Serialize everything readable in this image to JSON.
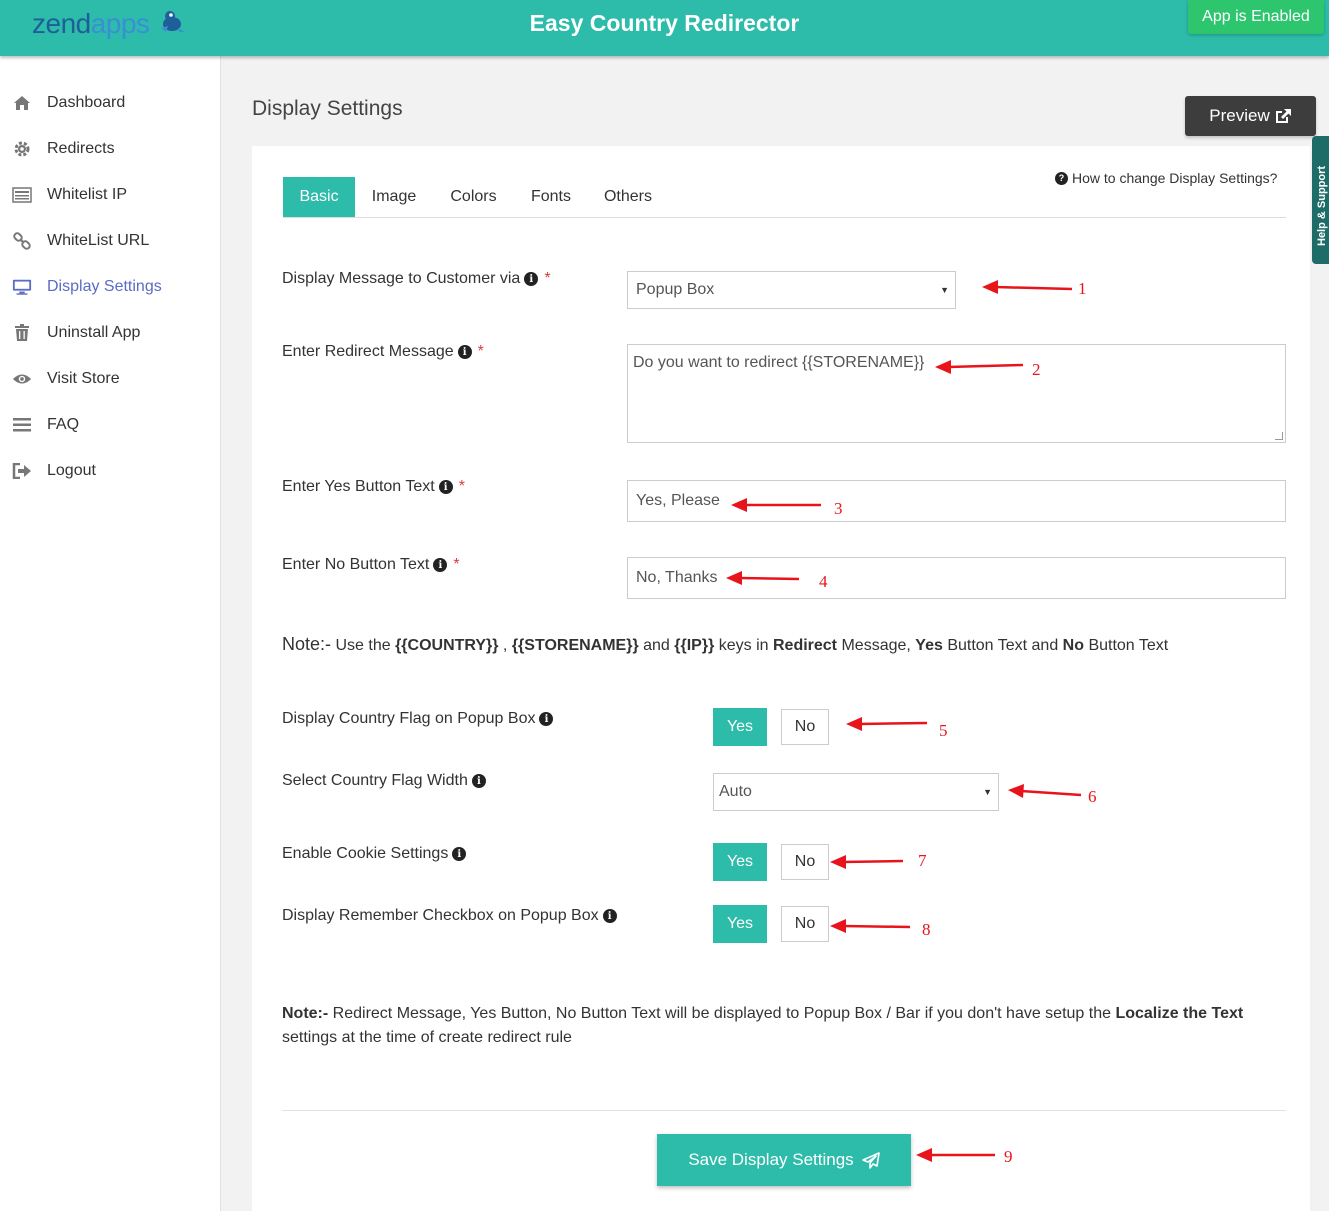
{
  "header": {
    "logo_part1": "zend",
    "logo_part2": "apps",
    "title": "Easy Country Redirector",
    "status_button": "App is Enabled"
  },
  "sidebar": {
    "items": [
      {
        "label": "Dashboard",
        "icon": "home-icon"
      },
      {
        "label": "Redirects",
        "icon": "gear-icon"
      },
      {
        "label": "Whitelist IP",
        "icon": "list-icon"
      },
      {
        "label": "WhiteList URL",
        "icon": "link-icon"
      },
      {
        "label": "Display Settings",
        "icon": "monitor-icon",
        "active": true
      },
      {
        "label": "Uninstall App",
        "icon": "trash-icon"
      },
      {
        "label": "Visit Store",
        "icon": "eye-icon"
      },
      {
        "label": "FAQ",
        "icon": "menu-icon"
      },
      {
        "label": "Logout",
        "icon": "logout-icon"
      }
    ]
  },
  "main": {
    "page_title": "Display Settings",
    "preview_label": "Preview",
    "help_tab_label": "Help & Support",
    "tabs": [
      {
        "label": "Basic",
        "active": true
      },
      {
        "label": "Image"
      },
      {
        "label": "Colors"
      },
      {
        "label": "Fonts"
      },
      {
        "label": "Others"
      }
    ],
    "howto_link": "How to change Display Settings?"
  },
  "form": {
    "display_via_label": "Display Message to Customer via",
    "display_via_value": "Popup Box",
    "redirect_msg_label": "Enter Redirect Message",
    "redirect_msg_value": "Do you want to redirect {{STORENAME}}",
    "yes_text_label": "Enter Yes Button Text",
    "yes_text_value": "Yes, Please",
    "no_text_label": "Enter No Button Text",
    "no_text_value": "No, Thanks",
    "required_mark": "*",
    "note1": {
      "lead": "Note:-",
      "t1": " Use the ",
      "k1": "{{COUNTRY}}",
      "t2": " , ",
      "k2": "{{STORENAME}}",
      "t3": " and ",
      "k3": "{{IP}}",
      "t4": " keys in ",
      "b1": "Redirect",
      "t5": " Message, ",
      "b2": "Yes",
      "t6": " Button Text and ",
      "b3": "No",
      "t7": " Button Text"
    },
    "flag_label": "Display Country Flag on Popup Box",
    "flag_width_label": "Select Country Flag Width",
    "flag_width_value": "Auto",
    "cookie_label": "Enable Cookie Settings",
    "remember_label": "Display Remember Checkbox on Popup Box",
    "yes": "Yes",
    "no": "No",
    "note2": {
      "lead": "Note:-",
      "t1": " Redirect Message, Yes Button, No Button Text will be displayed to Popup Box / Bar if you don't have setup the ",
      "b1": "Localize the Text",
      "t2": " settings at the time of create redirect rule"
    },
    "save_label": "Save Display Settings"
  },
  "annotations": [
    "1",
    "2",
    "3",
    "4",
    "5",
    "6",
    "7",
    "8",
    "9"
  ],
  "colors": {
    "brand": "#2dbcaa",
    "enabled": "#2ec56f",
    "sidebar_active": "#5a6bc4",
    "annotation_red": "#e8141b"
  }
}
